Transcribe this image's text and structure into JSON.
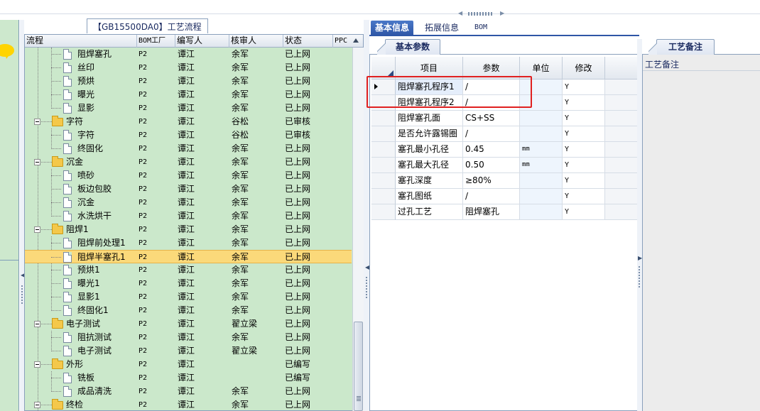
{
  "tree": {
    "tab_label": "【GB15500DA0】工艺流程",
    "columns": [
      "流程",
      "BOM工厂",
      "编写人",
      "核审人",
      "状态",
      "PPC"
    ],
    "rows": [
      {
        "name": "阻焊塞孔",
        "level": 2,
        "type": "doc",
        "bom": "P2",
        "author": "谭江",
        "reviewer": "余军",
        "status": "已上网"
      },
      {
        "name": "丝印",
        "level": 2,
        "type": "doc",
        "bom": "P2",
        "author": "谭江",
        "reviewer": "余军",
        "status": "已上网"
      },
      {
        "name": "预烘",
        "level": 2,
        "type": "doc",
        "bom": "P2",
        "author": "谭江",
        "reviewer": "余军",
        "status": "已上网"
      },
      {
        "name": "曝光",
        "level": 2,
        "type": "doc",
        "bom": "P2",
        "author": "谭江",
        "reviewer": "余军",
        "status": "已上网"
      },
      {
        "name": "显影",
        "level": 2,
        "type": "doc",
        "bom": "P2",
        "author": "谭江",
        "reviewer": "余军",
        "status": "已上网"
      },
      {
        "name": "字符",
        "level": 1,
        "type": "folder",
        "bom": "P2",
        "author": "谭江",
        "reviewer": "谷松",
        "status": "已审核"
      },
      {
        "name": "字符",
        "level": 2,
        "type": "doc",
        "bom": "P2",
        "author": "谭江",
        "reviewer": "谷松",
        "status": "已审核"
      },
      {
        "name": "终固化",
        "level": 2,
        "type": "doc",
        "bom": "P2",
        "author": "谭江",
        "reviewer": "余军",
        "status": "已上网"
      },
      {
        "name": "沉金",
        "level": 1,
        "type": "folder",
        "bom": "P2",
        "author": "谭江",
        "reviewer": "余军",
        "status": "已上网"
      },
      {
        "name": "喷砂",
        "level": 2,
        "type": "doc",
        "bom": "P2",
        "author": "谭江",
        "reviewer": "余军",
        "status": "已上网"
      },
      {
        "name": "板边包胶",
        "level": 2,
        "type": "doc",
        "bom": "P2",
        "author": "谭江",
        "reviewer": "余军",
        "status": "已上网"
      },
      {
        "name": "沉金",
        "level": 2,
        "type": "doc",
        "bom": "P2",
        "author": "谭江",
        "reviewer": "余军",
        "status": "已上网"
      },
      {
        "name": "水洗烘干",
        "level": 2,
        "type": "doc",
        "bom": "P2",
        "author": "谭江",
        "reviewer": "余军",
        "status": "已上网"
      },
      {
        "name": "阻焊1",
        "level": 1,
        "type": "folder",
        "bom": "P2",
        "author": "谭江",
        "reviewer": "余军",
        "status": "已上网"
      },
      {
        "name": "阻焊前处理1",
        "level": 2,
        "type": "doc",
        "bom": "P2",
        "author": "谭江",
        "reviewer": "余军",
        "status": "已上网"
      },
      {
        "name": "阻焊半塞孔1",
        "level": 2,
        "type": "doc",
        "bom": "P2",
        "author": "谭江",
        "reviewer": "余军",
        "status": "已上网",
        "selected": true
      },
      {
        "name": "预烘1",
        "level": 2,
        "type": "doc",
        "bom": "P2",
        "author": "谭江",
        "reviewer": "余军",
        "status": "已上网"
      },
      {
        "name": "曝光1",
        "level": 2,
        "type": "doc",
        "bom": "P2",
        "author": "谭江",
        "reviewer": "余军",
        "status": "已上网"
      },
      {
        "name": "显影1",
        "level": 2,
        "type": "doc",
        "bom": "P2",
        "author": "谭江",
        "reviewer": "余军",
        "status": "已上网"
      },
      {
        "name": "终固化1",
        "level": 2,
        "type": "doc",
        "bom": "P2",
        "author": "谭江",
        "reviewer": "余军",
        "status": "已上网"
      },
      {
        "name": "电子测试",
        "level": 1,
        "type": "folder",
        "bom": "P2",
        "author": "谭江",
        "reviewer": "翟立梁",
        "status": "已上网"
      },
      {
        "name": "阻抗测试",
        "level": 2,
        "type": "doc",
        "bom": "P2",
        "author": "谭江",
        "reviewer": "余军",
        "status": "已上网"
      },
      {
        "name": "电子测试",
        "level": 2,
        "type": "doc",
        "bom": "P2",
        "author": "谭江",
        "reviewer": "翟立梁",
        "status": "已上网"
      },
      {
        "name": "外形",
        "level": 1,
        "type": "folder",
        "bom": "P2",
        "author": "谭江",
        "reviewer": "",
        "status": "已编写"
      },
      {
        "name": "铣板",
        "level": 2,
        "type": "doc",
        "bom": "P2",
        "author": "谭江",
        "reviewer": "",
        "status": "已编写"
      },
      {
        "name": "成品清洗",
        "level": 2,
        "type": "doc",
        "bom": "P2",
        "author": "谭江",
        "reviewer": "余军",
        "status": "已上网"
      },
      {
        "name": "终检",
        "level": 1,
        "type": "folder",
        "bom": "P2",
        "author": "谭江",
        "reviewer": "余军",
        "status": "已上网"
      }
    ]
  },
  "middle": {
    "tabs": [
      "基本信息",
      "拓展信息",
      "BOM"
    ],
    "active_tab": 0,
    "sub_tab": "基本参数",
    "columns": [
      "项目",
      "参数",
      "单位",
      "修改"
    ],
    "rows": [
      {
        "item": "阻焊塞孔程序1",
        "param": "/",
        "unit": "",
        "mod": "Y"
      },
      {
        "item": "阻焊塞孔程序2",
        "param": "/",
        "unit": "",
        "mod": "Y"
      },
      {
        "item": "阻焊塞孔面",
        "param": "CS+SS",
        "unit": "",
        "mod": "Y"
      },
      {
        "item": "是否允许露锡圈",
        "param": "/",
        "unit": "",
        "mod": "Y"
      },
      {
        "item": "塞孔最小孔径",
        "param": "0.45",
        "unit": "mm",
        "mod": "Y"
      },
      {
        "item": "塞孔最大孔径",
        "param": "0.50",
        "unit": "mm",
        "mod": "Y"
      },
      {
        "item": "塞孔深度",
        "param": "≥80%",
        "unit": "",
        "mod": "Y"
      },
      {
        "item": "塞孔图纸",
        "param": "/",
        "unit": "",
        "mod": "Y"
      },
      {
        "item": "过孔工艺",
        "param": "阻焊塞孔",
        "unit": "",
        "mod": "Y"
      }
    ],
    "highlight_color": "#e02020"
  },
  "right": {
    "tab": "工艺备注",
    "label": "工艺备注"
  },
  "colors": {
    "tree_bg": "#cbe8cb",
    "selected_row": "#fbd97a",
    "active_tab": "#2e56a6"
  }
}
